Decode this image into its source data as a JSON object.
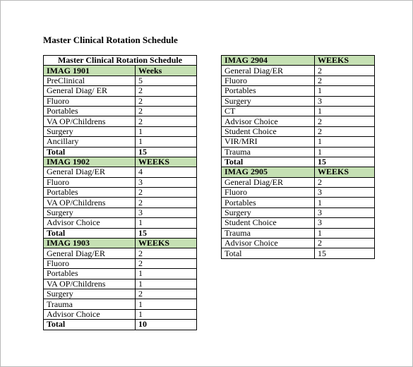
{
  "document": {
    "title": "Master Clinical Rotation Schedule",
    "header_color": "#c5e0b3"
  },
  "left_table": {
    "caption": "Master Clinical Rotation Schedule",
    "sections": [
      {
        "course": "IMAG 1901",
        "weeks_header": "Weeks",
        "rows": [
          {
            "rotation": "PreClinical",
            "weeks": "5"
          },
          {
            "rotation": "General Diag/ ER",
            "weeks": "2"
          },
          {
            "rotation": "Fluoro",
            "weeks": "2"
          },
          {
            "rotation": "Portables",
            "weeks": "2"
          },
          {
            "rotation": "VA OP/Childrens",
            "weeks": "2"
          },
          {
            "rotation": "Surgery",
            "weeks": "1"
          },
          {
            "rotation": "Ancillary",
            "weeks": "1"
          }
        ],
        "total_label": "Total",
        "total": "15"
      },
      {
        "course": "IMAG 1902",
        "weeks_header": "WEEKS",
        "rows": [
          {
            "rotation": "General Diag/ER",
            "weeks": "4"
          },
          {
            "rotation": "Fluoro",
            "weeks": "3"
          },
          {
            "rotation": "Portables",
            "weeks": "2"
          },
          {
            "rotation": "VA OP/Childrens",
            "weeks": "2"
          },
          {
            "rotation": "Surgery",
            "weeks": "3"
          },
          {
            "rotation": "Advisor Choice",
            "weeks": "1"
          }
        ],
        "total_label": "Total",
        "total": "15"
      },
      {
        "course": "IMAG 1903",
        "weeks_header": "WEEKS",
        "rows": [
          {
            "rotation": "General Diag/ER",
            "weeks": "2"
          },
          {
            "rotation": "Fluoro",
            "weeks": "2"
          },
          {
            "rotation": "Portables",
            "weeks": "1"
          },
          {
            "rotation": "VA OP/Childrens",
            "weeks": "1"
          },
          {
            "rotation": "Surgery",
            "weeks": "2"
          },
          {
            "rotation": "Trauma",
            "weeks": "1"
          },
          {
            "rotation": "Advisor Choice",
            "weeks": "1"
          }
        ],
        "total_label": "Total",
        "total": "10"
      }
    ]
  },
  "right_table": {
    "sections": [
      {
        "course": "IMAG 2904",
        "weeks_header": "WEEKS",
        "rows": [
          {
            "rotation": "General Diag/ER",
            "weeks": "2"
          },
          {
            "rotation": "Fluoro",
            "weeks": "2"
          },
          {
            "rotation": "Portables",
            "weeks": "1"
          },
          {
            "rotation": "Surgery",
            "weeks": "3"
          },
          {
            "rotation": "CT",
            "weeks": "1"
          },
          {
            "rotation": "Advisor Choice",
            "weeks": "2"
          },
          {
            "rotation": "Student Choice",
            "weeks": "2"
          },
          {
            "rotation": "VIR/MRI",
            "weeks": "1"
          },
          {
            "rotation": "Trauma",
            "weeks": "1"
          }
        ],
        "total_label": "Total",
        "total": "15"
      },
      {
        "course": "IMAG 2905",
        "weeks_header": "WEEKS",
        "rows": [
          {
            "rotation": "General Diag/ER",
            "weeks": "2"
          },
          {
            "rotation": "Fluoro",
            "weeks": "3"
          },
          {
            "rotation": "Portables",
            "weeks": "1"
          },
          {
            "rotation": "Surgery",
            "weeks": "3"
          },
          {
            "rotation": "Student Choice",
            "weeks": "3"
          },
          {
            "rotation": "Trauma",
            "weeks": "1"
          },
          {
            "rotation": "Advisor Choice",
            "weeks": "2"
          }
        ],
        "total_label": "Total",
        "total": "15"
      }
    ]
  }
}
